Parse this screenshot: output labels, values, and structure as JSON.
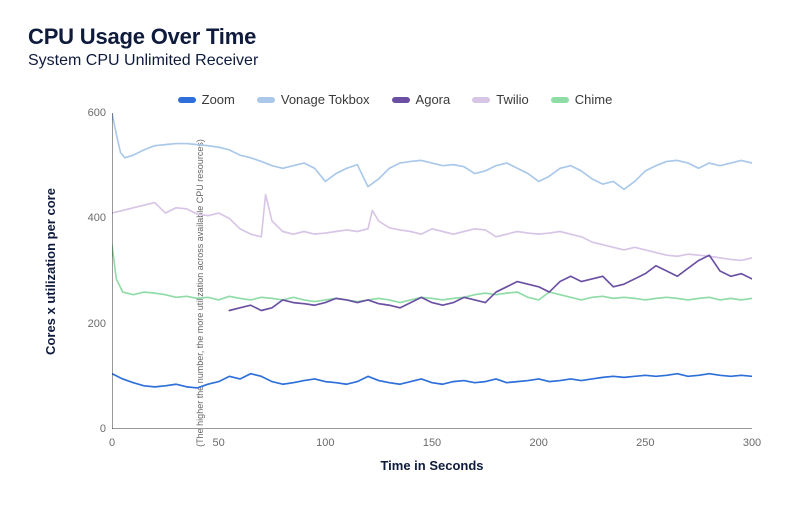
{
  "title": "CPU Usage Over Time",
  "subtitle": "System CPU Unlimited Receiver",
  "xlabel": "Time in Seconds",
  "ylabel": "Cores x utilization per core",
  "ylabel_sub": "(The higher the number, the more utilization across available CPU resources)",
  "legend": [
    {
      "name": "Zoom",
      "color": "#2e6fd9"
    },
    {
      "name": "Vonage Tokbox",
      "color": "#a9c8ea"
    },
    {
      "name": "Agora",
      "color": "#6a4fa3"
    },
    {
      "name": "Twilio",
      "color": "#d7c5e6"
    },
    {
      "name": "Chime",
      "color": "#8fdca7"
    }
  ],
  "chart_data": {
    "type": "line",
    "title": "CPU Usage Over Time",
    "xlabel": "Time in Seconds",
    "ylabel": "Cores x utilization per core",
    "xlim": [
      0,
      300
    ],
    "ylim": [
      0,
      600
    ],
    "x_ticks": [
      0,
      50,
      100,
      150,
      200,
      250,
      300
    ],
    "y_ticks": [
      0,
      200,
      400,
      600
    ],
    "series": [
      {
        "name": "Zoom",
        "color": "#2e6fd9",
        "x": [
          0,
          5,
          10,
          15,
          20,
          25,
          30,
          35,
          40,
          45,
          50,
          55,
          60,
          65,
          70,
          75,
          80,
          85,
          90,
          95,
          100,
          105,
          110,
          115,
          120,
          125,
          130,
          135,
          140,
          145,
          150,
          155,
          160,
          165,
          170,
          175,
          180,
          185,
          190,
          195,
          200,
          205,
          210,
          215,
          220,
          225,
          230,
          235,
          240,
          245,
          250,
          255,
          260,
          265,
          270,
          275,
          280,
          285,
          290,
          295,
          300
        ],
        "y": [
          105,
          95,
          88,
          82,
          80,
          82,
          85,
          80,
          78,
          85,
          90,
          100,
          95,
          105,
          100,
          90,
          85,
          88,
          92,
          95,
          90,
          88,
          85,
          90,
          100,
          92,
          88,
          85,
          90,
          95,
          88,
          85,
          90,
          92,
          88,
          90,
          95,
          88,
          90,
          92,
          95,
          90,
          92,
          95,
          92,
          95,
          98,
          100,
          98,
          100,
          102,
          100,
          102,
          105,
          100,
          102,
          105,
          102,
          100,
          102,
          100
        ]
      },
      {
        "name": "Vonage Tokbox",
        "color": "#a9c8ea",
        "x": [
          0,
          2,
          4,
          6,
          10,
          15,
          20,
          25,
          30,
          35,
          40,
          45,
          50,
          55,
          60,
          65,
          70,
          75,
          80,
          85,
          90,
          95,
          100,
          105,
          110,
          115,
          120,
          125,
          130,
          135,
          140,
          145,
          150,
          155,
          160,
          165,
          170,
          175,
          180,
          185,
          190,
          195,
          200,
          205,
          210,
          215,
          220,
          225,
          230,
          235,
          240,
          245,
          250,
          255,
          260,
          265,
          270,
          275,
          280,
          285,
          290,
          295,
          300
        ],
        "y": [
          600,
          560,
          525,
          515,
          520,
          530,
          538,
          540,
          542,
          542,
          540,
          538,
          535,
          530,
          520,
          515,
          508,
          500,
          495,
          500,
          505,
          495,
          470,
          485,
          495,
          502,
          460,
          475,
          495,
          505,
          508,
          510,
          505,
          500,
          502,
          498,
          485,
          490,
          500,
          505,
          495,
          485,
          470,
          480,
          495,
          500,
          490,
          475,
          465,
          470,
          455,
          470,
          490,
          500,
          508,
          510,
          505,
          495,
          505,
          500,
          505,
          510,
          505
        ]
      },
      {
        "name": "Agora",
        "color": "#6a4fa3",
        "x": [
          55,
          60,
          65,
          70,
          75,
          80,
          85,
          90,
          95,
          100,
          105,
          110,
          115,
          120,
          125,
          130,
          135,
          140,
          145,
          150,
          155,
          160,
          165,
          170,
          175,
          180,
          185,
          190,
          195,
          200,
          205,
          210,
          215,
          220,
          225,
          230,
          235,
          240,
          245,
          250,
          255,
          260,
          265,
          270,
          275,
          280,
          285,
          290,
          295,
          300
        ],
        "y": [
          225,
          230,
          235,
          225,
          230,
          245,
          240,
          238,
          235,
          240,
          248,
          245,
          240,
          245,
          238,
          235,
          230,
          240,
          250,
          240,
          235,
          240,
          250,
          245,
          240,
          260,
          270,
          280,
          275,
          270,
          260,
          280,
          290,
          280,
          285,
          290,
          270,
          275,
          285,
          295,
          310,
          300,
          290,
          305,
          320,
          330,
          300,
          290,
          295,
          285
        ]
      },
      {
        "name": "Twilio",
        "color": "#d7c5e6",
        "x": [
          0,
          5,
          10,
          15,
          20,
          25,
          30,
          35,
          40,
          45,
          50,
          55,
          60,
          65,
          70,
          72,
          75,
          80,
          85,
          90,
          95,
          100,
          105,
          110,
          115,
          120,
          122,
          125,
          130,
          135,
          140,
          145,
          150,
          155,
          160,
          165,
          170,
          175,
          180,
          185,
          190,
          195,
          200,
          205,
          210,
          215,
          220,
          225,
          230,
          235,
          240,
          245,
          250,
          255,
          260,
          265,
          270,
          275,
          280,
          285,
          290,
          295,
          300
        ],
        "y": [
          410,
          415,
          420,
          425,
          430,
          410,
          420,
          418,
          408,
          405,
          410,
          400,
          380,
          370,
          365,
          445,
          395,
          375,
          370,
          375,
          370,
          372,
          375,
          378,
          375,
          380,
          415,
          395,
          382,
          378,
          375,
          370,
          380,
          375,
          370,
          375,
          380,
          378,
          365,
          370,
          375,
          372,
          370,
          372,
          375,
          370,
          365,
          355,
          350,
          345,
          340,
          345,
          340,
          335,
          330,
          328,
          332,
          330,
          328,
          325,
          322,
          320,
          325
        ]
      },
      {
        "name": "Chime",
        "color": "#8fdca7",
        "x": [
          0,
          2,
          5,
          10,
          15,
          20,
          25,
          30,
          35,
          40,
          45,
          50,
          55,
          60,
          65,
          70,
          75,
          80,
          85,
          90,
          95,
          100,
          105,
          110,
          115,
          120,
          125,
          130,
          135,
          140,
          145,
          150,
          155,
          160,
          165,
          170,
          175,
          180,
          185,
          190,
          195,
          200,
          205,
          210,
          215,
          220,
          225,
          230,
          235,
          240,
          245,
          250,
          255,
          260,
          265,
          270,
          275,
          280,
          285,
          290,
          295,
          300
        ],
        "y": [
          350,
          285,
          260,
          255,
          260,
          258,
          255,
          250,
          252,
          248,
          250,
          245,
          252,
          248,
          245,
          250,
          248,
          245,
          250,
          245,
          242,
          245,
          248,
          245,
          242,
          245,
          248,
          245,
          240,
          245,
          250,
          248,
          245,
          248,
          250,
          255,
          258,
          255,
          258,
          260,
          250,
          245,
          260,
          255,
          250,
          245,
          250,
          252,
          248,
          250,
          248,
          245,
          248,
          250,
          248,
          245,
          248,
          250,
          245,
          248,
          245,
          248
        ]
      }
    ]
  }
}
